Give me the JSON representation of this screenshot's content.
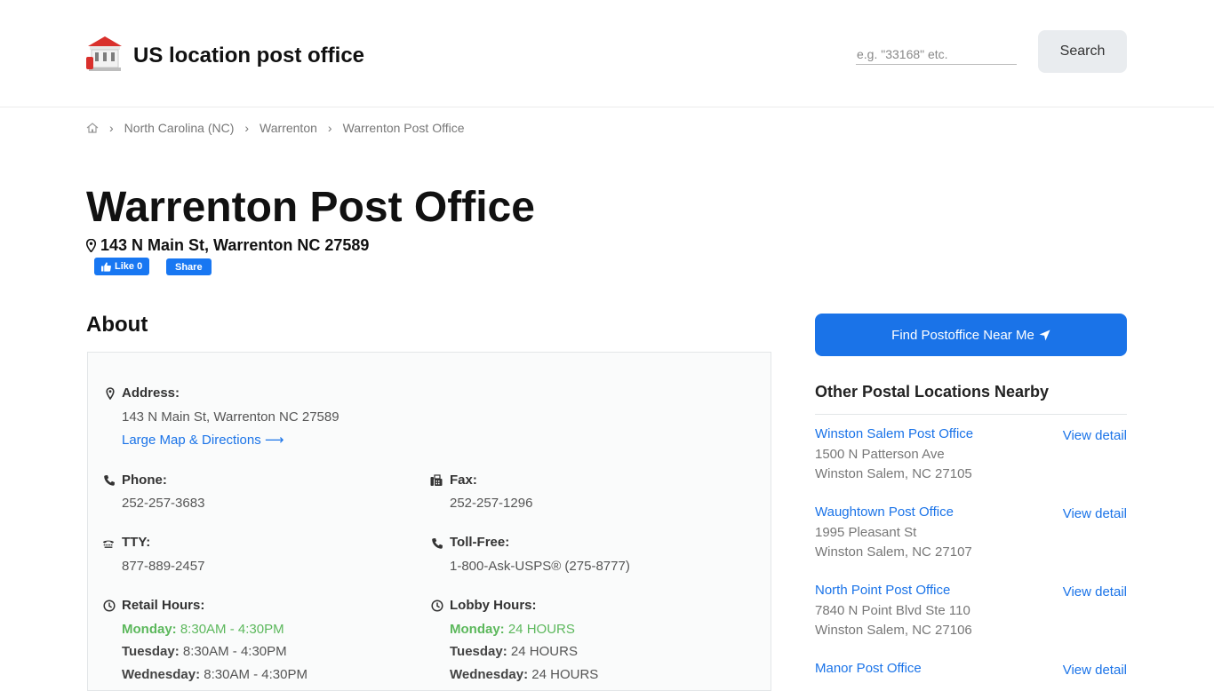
{
  "header": {
    "site_title": "US location post office",
    "search_placeholder": "e.g. \"33168\" etc.",
    "search_button": "Search"
  },
  "breadcrumb": {
    "items": [
      "North Carolina (NC)",
      "Warrenton",
      "Warrenton Post Office"
    ]
  },
  "page": {
    "title": "Warrenton Post Office",
    "address": "143 N Main St, Warrenton NC 27589",
    "like_label": "Like 0",
    "share_label": "Share"
  },
  "about": {
    "heading": "About",
    "address_label": "Address:",
    "address_value": "143 N Main St, Warrenton NC 27589",
    "map_link": "Large Map & Directions",
    "phone_label": "Phone:",
    "phone_value": "252-257-3683",
    "fax_label": "Fax:",
    "fax_value": "252-257-1296",
    "tty_label": "TTY:",
    "tty_value": "877-889-2457",
    "tollfree_label": "Toll-Free:",
    "tollfree_value": "1-800-Ask-USPS® (275-8777)",
    "retail_label": "Retail Hours:",
    "retail_hours": [
      {
        "day": "Monday:",
        "hours": "8:30AM - 4:30PM"
      },
      {
        "day": "Tuesday:",
        "hours": "8:30AM - 4:30PM"
      },
      {
        "day": "Wednesday:",
        "hours": "8:30AM - 4:30PM"
      }
    ],
    "lobby_label": "Lobby Hours:",
    "lobby_hours": [
      {
        "day": "Monday:",
        "hours": "24 HOURS"
      },
      {
        "day": "Tuesday:",
        "hours": "24 HOURS"
      },
      {
        "day": "Wednesday:",
        "hours": "24 HOURS"
      }
    ]
  },
  "sidebar": {
    "near_button": "Find Postoffice Near Me",
    "nearby_heading": "Other Postal Locations Nearby",
    "view_label": "View detail",
    "locations": [
      {
        "name": "Winston Salem Post Office",
        "street": "1500 N Patterson Ave",
        "city": "Winston Salem, NC 27105"
      },
      {
        "name": "Waughtown Post Office",
        "street": "1995 Pleasant St",
        "city": "Winston Salem, NC 27107"
      },
      {
        "name": "North Point Post Office",
        "street": "7840 N Point Blvd Ste 110",
        "city": "Winston Salem, NC 27106"
      },
      {
        "name": "Manor Post Office",
        "street": "",
        "city": ""
      }
    ]
  },
  "colors": {
    "accent": "#1a73e8",
    "facebook": "#1877f2",
    "today": "#5cb85c",
    "logo_red": "#d9302c"
  }
}
